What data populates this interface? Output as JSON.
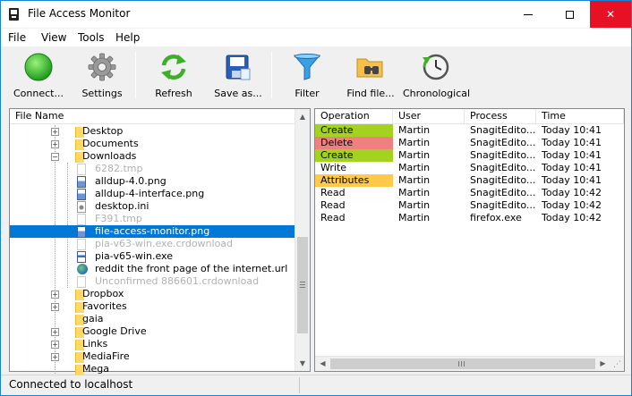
{
  "window": {
    "title": "File Access Monitor",
    "close_glyph": "✕"
  },
  "menu": [
    "File",
    "View",
    "Tools",
    "Help"
  ],
  "toolbar": {
    "connect": "Connect...",
    "settings": "Settings",
    "refresh": "Refresh",
    "save_as": "Save as...",
    "filter": "Filter",
    "find_file": "Find file...",
    "chronological": "Chronological"
  },
  "tree": {
    "header": "File Name",
    "rows": [
      {
        "label": "Desktop",
        "kind": "folder",
        "expander": "+",
        "dim": false
      },
      {
        "label": "Documents",
        "kind": "folder",
        "expander": "+",
        "dim": false
      },
      {
        "label": "Downloads",
        "kind": "folder",
        "expander": "−",
        "dim": false
      },
      {
        "label": "6282.tmp",
        "kind": "file",
        "dim": true
      },
      {
        "label": "alldup-4.0.png",
        "kind": "img",
        "dim": false
      },
      {
        "label": "alldup-4-interface.png",
        "kind": "img",
        "dim": false
      },
      {
        "label": "desktop.ini",
        "kind": "ini",
        "dim": false
      },
      {
        "label": "F391.tmp",
        "kind": "file",
        "dim": true
      },
      {
        "label": "file-access-monitor.png",
        "kind": "img",
        "dim": false,
        "selected": true
      },
      {
        "label": "pia-v63-win.exe.crdownload",
        "kind": "file",
        "dim": true
      },
      {
        "label": "pia-v65-win.exe",
        "kind": "exe",
        "dim": false
      },
      {
        "label": "reddit the front page of the internet.url",
        "kind": "url",
        "dim": false
      },
      {
        "label": "Unconfirmed 886601.crdownload",
        "kind": "file",
        "dim": true
      },
      {
        "label": "Dropbox",
        "kind": "folder",
        "expander": "+",
        "dim": false
      },
      {
        "label": "Favorites",
        "kind": "folder",
        "expander": "+",
        "dim": false
      },
      {
        "label": "gaia",
        "kind": "folder",
        "dim": false
      },
      {
        "label": "Google Drive",
        "kind": "folder",
        "expander": "+",
        "dim": false
      },
      {
        "label": "Links",
        "kind": "folder",
        "expander": "+",
        "dim": false
      },
      {
        "label": "MediaFire",
        "kind": "folder",
        "expander": "+",
        "dim": false
      },
      {
        "label": "Mega",
        "kind": "folder",
        "dim": false
      }
    ]
  },
  "list": {
    "headers": [
      "Operation",
      "User",
      "Process",
      "Time"
    ],
    "rows": [
      {
        "operation": "Create",
        "op_color": "create",
        "user": "Martin",
        "process": "SnagitEdito...",
        "time": "Today 10:41"
      },
      {
        "operation": "Delete",
        "op_color": "delete",
        "user": "Martin",
        "process": "SnagitEdito...",
        "time": "Today 10:41"
      },
      {
        "operation": "Create",
        "op_color": "create",
        "user": "Martin",
        "process": "SnagitEdito...",
        "time": "Today 10:41"
      },
      {
        "operation": "Write",
        "op_color": "",
        "user": "Martin",
        "process": "SnagitEdito...",
        "time": "Today 10:41"
      },
      {
        "operation": "Attributes",
        "op_color": "attr",
        "user": "Martin",
        "process": "SnagitEdito...",
        "time": "Today 10:41"
      },
      {
        "operation": "Read",
        "op_color": "",
        "user": "Martin",
        "process": "SnagitEdito...",
        "time": "Today 10:42"
      },
      {
        "operation": "Read",
        "op_color": "",
        "user": "Martin",
        "process": "SnagitEdito...",
        "time": "Today 10:42"
      },
      {
        "operation": "Read",
        "op_color": "",
        "user": "Martin",
        "process": "firefox.exe",
        "time": "Today 10:42"
      }
    ]
  },
  "status": {
    "text": "Connected to localhost"
  },
  "colors": {
    "create": "#a4d31f",
    "delete": "#f08080",
    "attributes": "#ffc94a",
    "selection": "#0078d7"
  }
}
